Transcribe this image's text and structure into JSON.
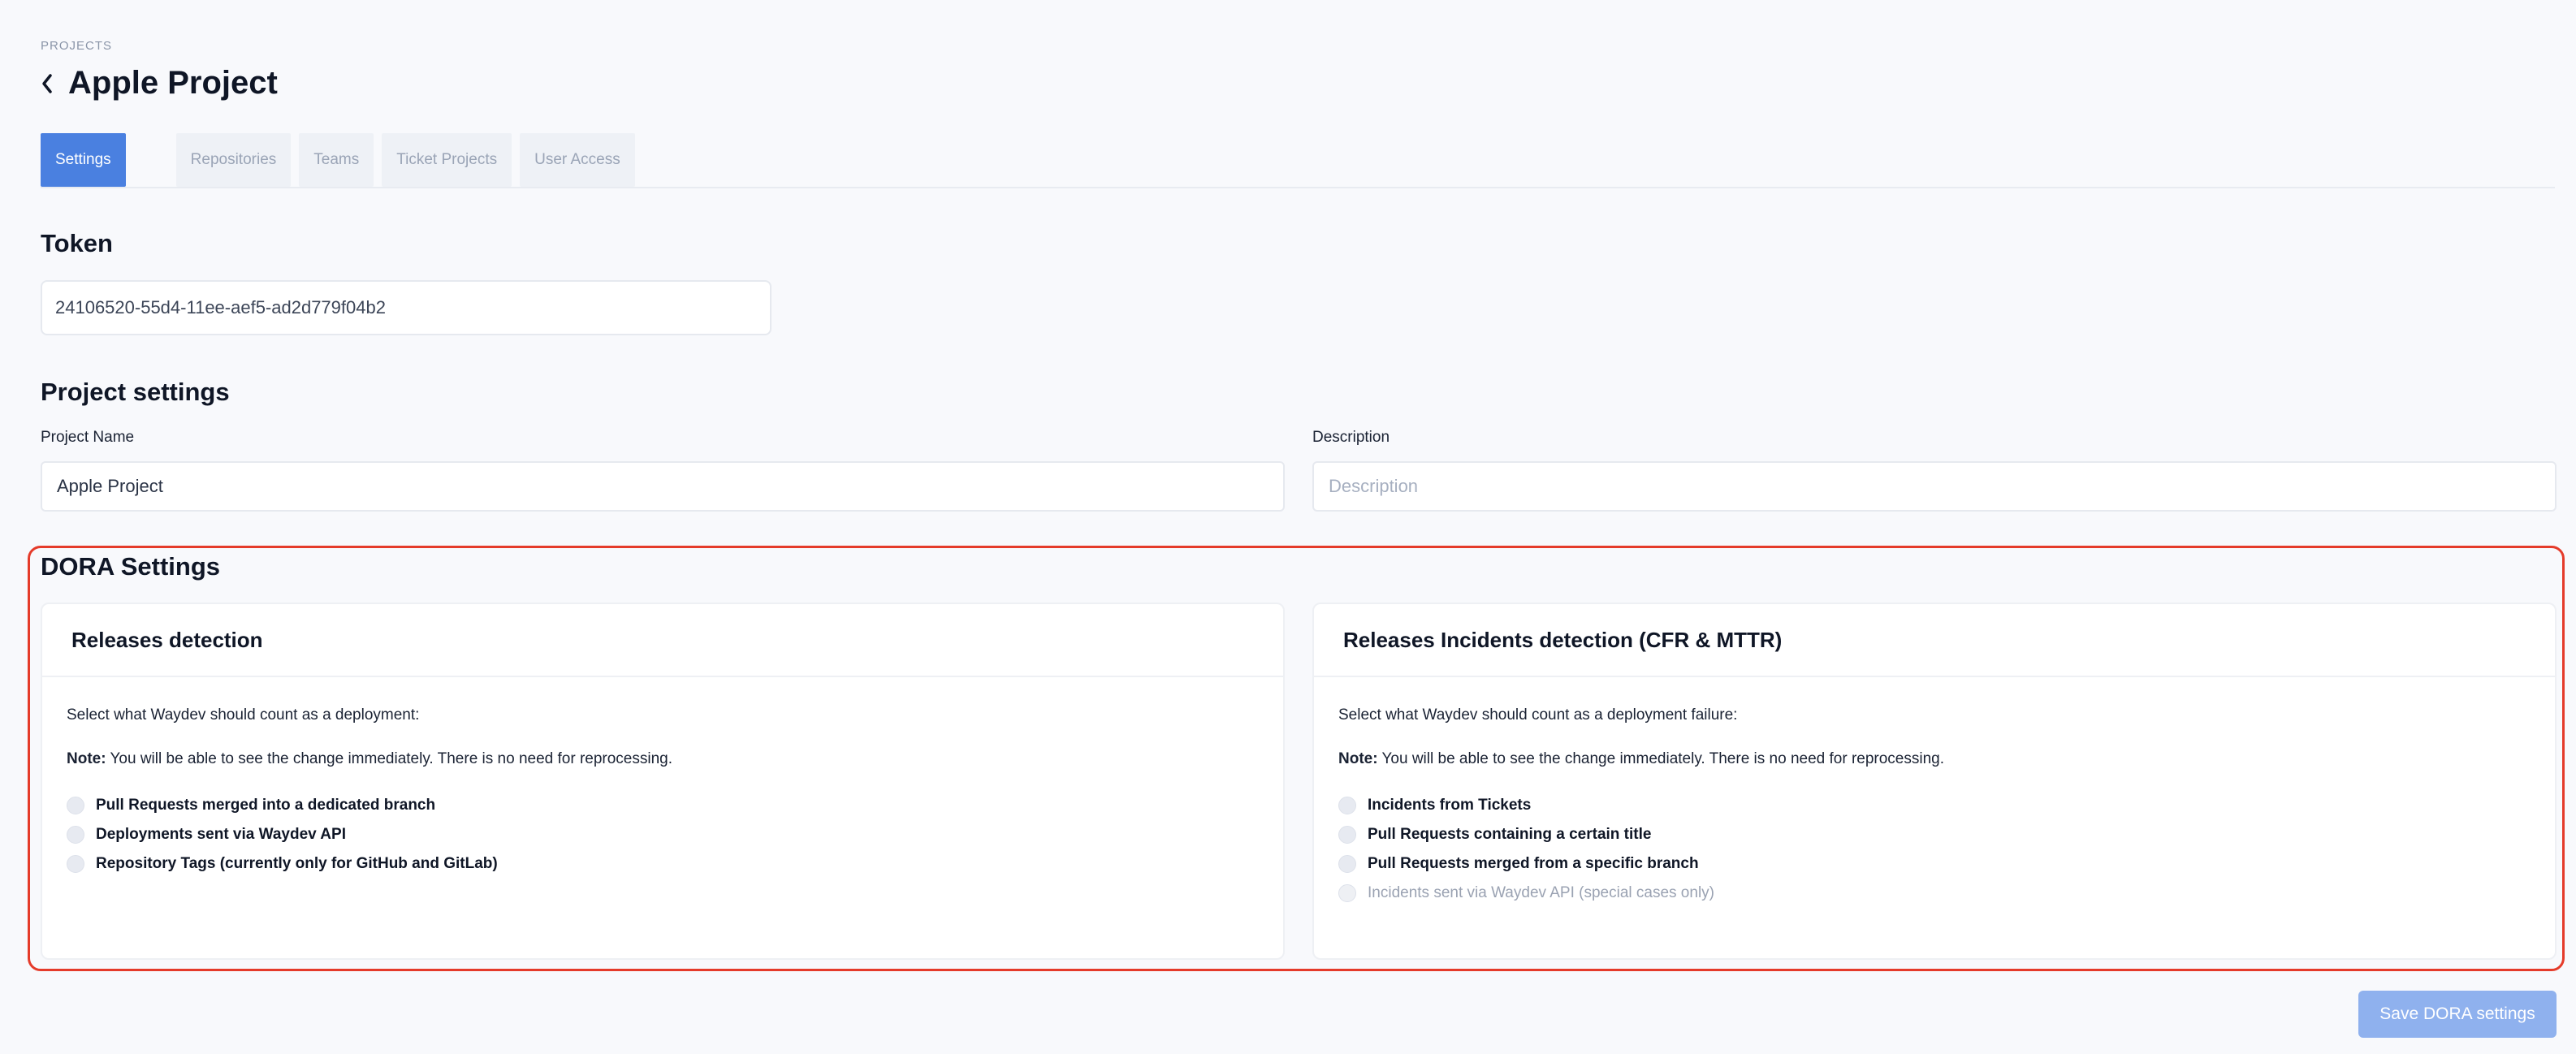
{
  "breadcrumb": "PROJECTS",
  "title": "Apple Project",
  "tabs": [
    {
      "label": "Settings",
      "active": true
    },
    {
      "label": "Repositories",
      "active": false
    },
    {
      "label": "Teams",
      "active": false
    },
    {
      "label": "Ticket Projects",
      "active": false
    },
    {
      "label": "User Access",
      "active": false
    }
  ],
  "token": {
    "heading": "Token",
    "value": "24106520-55d4-11ee-aef5-ad2d779f04b2"
  },
  "project_settings": {
    "heading": "Project settings",
    "name_label": "Project Name",
    "name_value": "Apple Project",
    "description_label": "Description",
    "description_placeholder": "Description"
  },
  "dora": {
    "heading": "DORA Settings",
    "releases": {
      "title": "Releases detection",
      "instruction": "Select what Waydev should count as a deployment:",
      "note_label": "Note:",
      "note_text": " You will be able to see the change immediately. There is no need for reprocessing.",
      "options": [
        "Pull Requests merged into a dedicated branch",
        "Deployments sent via Waydev API",
        "Repository Tags (currently only for GitHub and GitLab)"
      ]
    },
    "incidents": {
      "title": "Releases Incidents detection (CFR & MTTR)",
      "instruction": "Select what Waydev should count as a deployment failure:",
      "note_label": "Note:",
      "note_text": " You will be able to see the change immediately. There is no need for reprocessing.",
      "options": [
        "Incidents from Tickets",
        "Pull Requests containing a certain title",
        "Pull Requests merged from a specific branch",
        "Incidents sent via Waydev API (special cases only)"
      ]
    },
    "save_label": "Save DORA settings"
  },
  "colors": {
    "accent": "#4a80e0",
    "highlight_outline": "#e53b2a",
    "save_button": "#8fb1ee"
  },
  "icons": {
    "back": "chevron-left-icon"
  }
}
